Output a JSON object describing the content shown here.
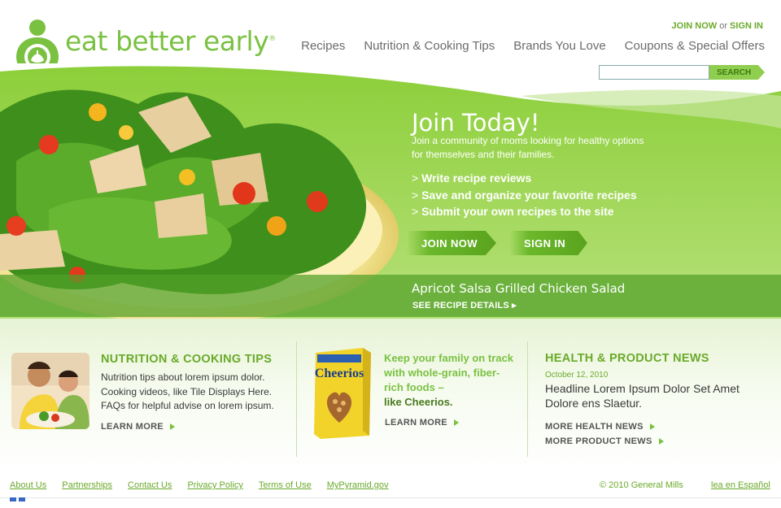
{
  "header": {
    "logo_text": "eat better early",
    "logo_mark": "®",
    "join_label": "JOIN NOW",
    "or_label": "or",
    "signin_label": "SIGN IN",
    "nav": [
      "Recipes",
      "Nutrition & Cooking Tips",
      "Brands You Love",
      "Coupons & Special Offers"
    ],
    "search_button": "SEARCH"
  },
  "hero": {
    "title": "Join Today!",
    "description": "Join a community of moms looking for healthy options for themselves and their families.",
    "benefits": [
      "Write recipe reviews",
      "Save and organize your favorite recipes",
      "Submit your own recipes to the site"
    ],
    "join_button": "JOIN NOW",
    "signin_button": "SIGN IN",
    "recipe_title": "Apricot Salsa Grilled Chicken Salad",
    "recipe_link": "SEE RECIPE DETAILS ▸"
  },
  "features": {
    "tips": {
      "title": "NUTRITION & COOKING TIPS",
      "text": "Nutrition tips about lorem ipsum dolor. Cooking videos, like Tile Displays Here. FAQs for helpful advise on lorem ipsum.",
      "learn_more": "LEARN MORE"
    },
    "cheerios": {
      "line1": "Keep your family on track with whole-grain, fiber-rich foods –",
      "line2": "like Cheerios.",
      "learn_more": "LEARN MORE",
      "box_brand": "Cheerios"
    },
    "news": {
      "title": "HEALTH & PRODUCT NEWS",
      "date": "October 12, 2010",
      "headline": "Headline Lorem Ipsum Dolor Set Amet Dolore ens Slaetur.",
      "more_health": "MORE HEALTH NEWS",
      "more_product": "MORE PRODUCT NEWS"
    }
  },
  "footer": {
    "links": [
      "About Us",
      "Partnerships",
      "Contact Us",
      "Privacy Policy",
      "Terms of Use",
      "MyPyramid.gov"
    ],
    "copyright": "© 2010 General Mills",
    "spanish": "lea en Español"
  },
  "colors": {
    "brand_green": "#7ac142",
    "dark_green": "#4a7a1f",
    "hero_green": "#6bb82b"
  }
}
